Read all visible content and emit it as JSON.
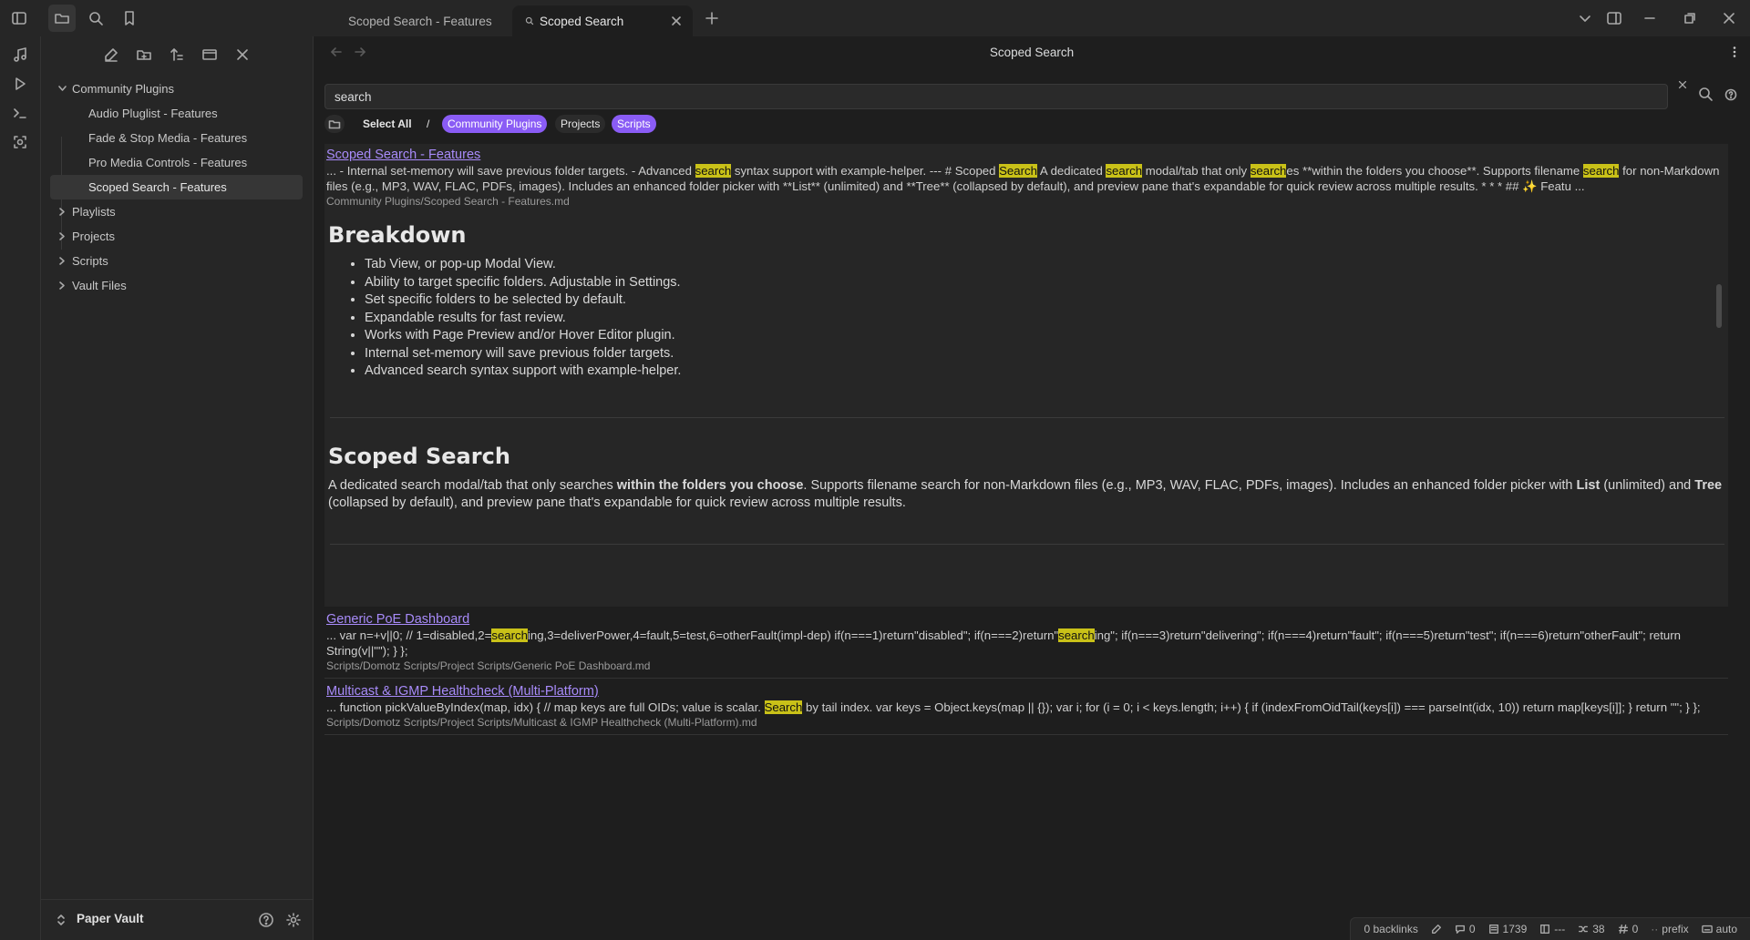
{
  "tabs": [
    {
      "label": "Scoped Search - Features"
    },
    {
      "label": "Scoped Search"
    }
  ],
  "sidebar": {
    "items": [
      {
        "label": "Community Plugins"
      },
      {
        "label": "Audio Pluglist - Features"
      },
      {
        "label": "Fade & Stop Media - Features"
      },
      {
        "label": "Pro Media Controls - Features"
      },
      {
        "label": "Scoped Search - Features"
      },
      {
        "label": "Playlists"
      },
      {
        "label": "Projects"
      },
      {
        "label": "Scripts"
      },
      {
        "label": "Vault Files"
      }
    ],
    "vault_name": "Paper Vault"
  },
  "view": {
    "title": "Scoped Search",
    "search_value": "search"
  },
  "filters": {
    "select_all": "Select All",
    "root": "/",
    "chips": [
      "Community Plugins",
      "Projects",
      "Scripts"
    ]
  },
  "results": [
    {
      "title": "Scoped Search - Features",
      "path": "Community Plugins/Scoped Search - Features.md",
      "snippet": {
        "t0": "... - Internal set-memory will save previous folder targets. - Advanced ",
        "m0": "search",
        "t1": " syntax support with example-helper. --- # Scoped ",
        "m1": "Search",
        "t2": " A dedicated ",
        "m2": "search",
        "t3": " modal/tab that only ",
        "m3": "search",
        "t4": "es **within the folders you choose**. Supports filename ",
        "m4": "search",
        "t5": " for non-Markdown files (e.g., MP3, WAV, FLAC, PDFs, images). Includes an enhanced folder picker with **List** (unlimited) and **Tree** (collapsed by default), and preview pane that's expandable for quick review across multiple results. * * * ## ✨ Featu ..."
      },
      "preview": {
        "h1": "Breakdown",
        "bullets": [
          "Tab View, or pop-up Modal View.",
          "Ability to target specific folders. Adjustable in Settings.",
          "Set specific folders to be selected by default.",
          "Expandable results for fast review.",
          "Works with Page Preview and/or Hover Editor plugin.",
          "Internal set-memory will save previous folder targets.",
          "Advanced search syntax support with example-helper."
        ],
        "h2": "Scoped Search",
        "p": {
          "a": "A dedicated search modal/tab that only searches ",
          "b": "within the folders you choose",
          "c": ". Supports filename search for non-Markdown files (e.g., MP3, WAV, FLAC, PDFs, images). Includes an enhanced folder picker with ",
          "d": "List",
          "e": " (unlimited) and ",
          "f": "Tree",
          "g": " (collapsed by default), and preview pane that's expandable for quick review across multiple results."
        }
      }
    },
    {
      "title": "Generic PoE Dashboard",
      "path": "Scripts/Domotz Scripts/Project Scripts/Generic PoE Dashboard.md",
      "snippet": {
        "t0": "... var n=+v||0; // 1=disabled,2=",
        "m0": "search",
        "t1": "ing,3=deliverPower,4=fault,5=test,6=otherFault(impl-dep) if(n===1)return\"disabled\"; if(n===2)return\"",
        "m1": "search",
        "t2": "ing\"; if(n===3)return\"delivering\"; if(n===4)return\"fault\"; if(n===5)return\"test\"; if(n===6)return\"otherFault\"; return String(v||\"\"); } };"
      }
    },
    {
      "title": "Multicast & IGMP Healthcheck (Multi-Platform)",
      "path": "Scripts/Domotz Scripts/Project Scripts/Multicast & IGMP Healthcheck (Multi-Platform).md",
      "snippet": {
        "t0": "... function pickValueByIndex(map, idx) { // map keys are full OIDs; value is scalar. ",
        "m0": "Search",
        "t1": " by tail index. var keys = Object.keys(map || {}); var i; for (i = 0; i < keys.length; i++) { if (indexFromOidTail(keys[i]) === parseInt(idx, 10)) return map[keys[i]]; } return \"\"; } };"
      }
    }
  ],
  "status": {
    "backlinks": "0 backlinks",
    "comments": "0",
    "words": "1739",
    "table": "---",
    "links": "38",
    "tags": "0",
    "prefix": "prefix",
    "auto": "auto"
  },
  "icons": [
    "sidebar-toggle-icon",
    "folder-icon",
    "search-icon",
    "bookmark-icon",
    "music-icon",
    "play-icon",
    "terminal-icon",
    "scan-icon",
    "new-note-icon",
    "new-folder-icon",
    "sort-icon",
    "collapse-icon",
    "close-icon",
    "plus-icon",
    "chevron-down-icon",
    "layout-icon",
    "minimize-icon",
    "maximize-icon",
    "back-icon",
    "forward-icon",
    "more-icon",
    "help-icon",
    "gear-icon",
    "vault-switch-icon"
  ]
}
